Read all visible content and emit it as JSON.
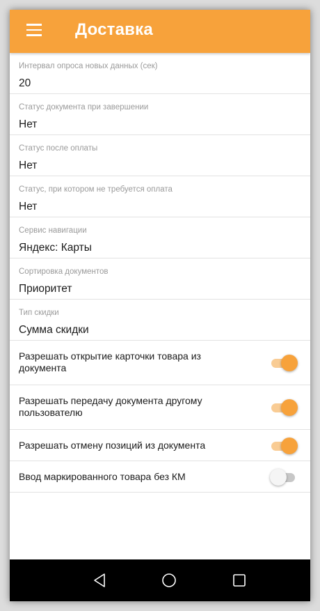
{
  "app": {
    "title": "Доставка",
    "accent_color": "#f7a23b"
  },
  "settings": [
    {
      "label": "Интервал опроса новых данных (сек)",
      "value": "20"
    },
    {
      "label": "Статус документа при завершении",
      "value": "Нет"
    },
    {
      "label": "Статус после оплаты",
      "value": "Нет"
    },
    {
      "label": "Статус, при котором не требуется оплата",
      "value": "Нет"
    },
    {
      "label": "Сервис навигации",
      "value": "Яндекс: Карты"
    },
    {
      "label": "Сортировка документов",
      "value": "Приоритет"
    },
    {
      "label": "Тип скидки",
      "value": "Сумма скидки"
    }
  ],
  "toggles": [
    {
      "label": "Разрешать открытие карточки товара из документа",
      "checked": true
    },
    {
      "label": "Разрешать передачу документа другому пользователю",
      "checked": true
    },
    {
      "label": "Разрешать отмену позиций из документа",
      "checked": true
    },
    {
      "label": "Ввод маркированного товара без КМ",
      "checked": false
    }
  ],
  "navbar": {
    "buttons": [
      "back-icon",
      "home-icon",
      "recents-icon"
    ]
  }
}
